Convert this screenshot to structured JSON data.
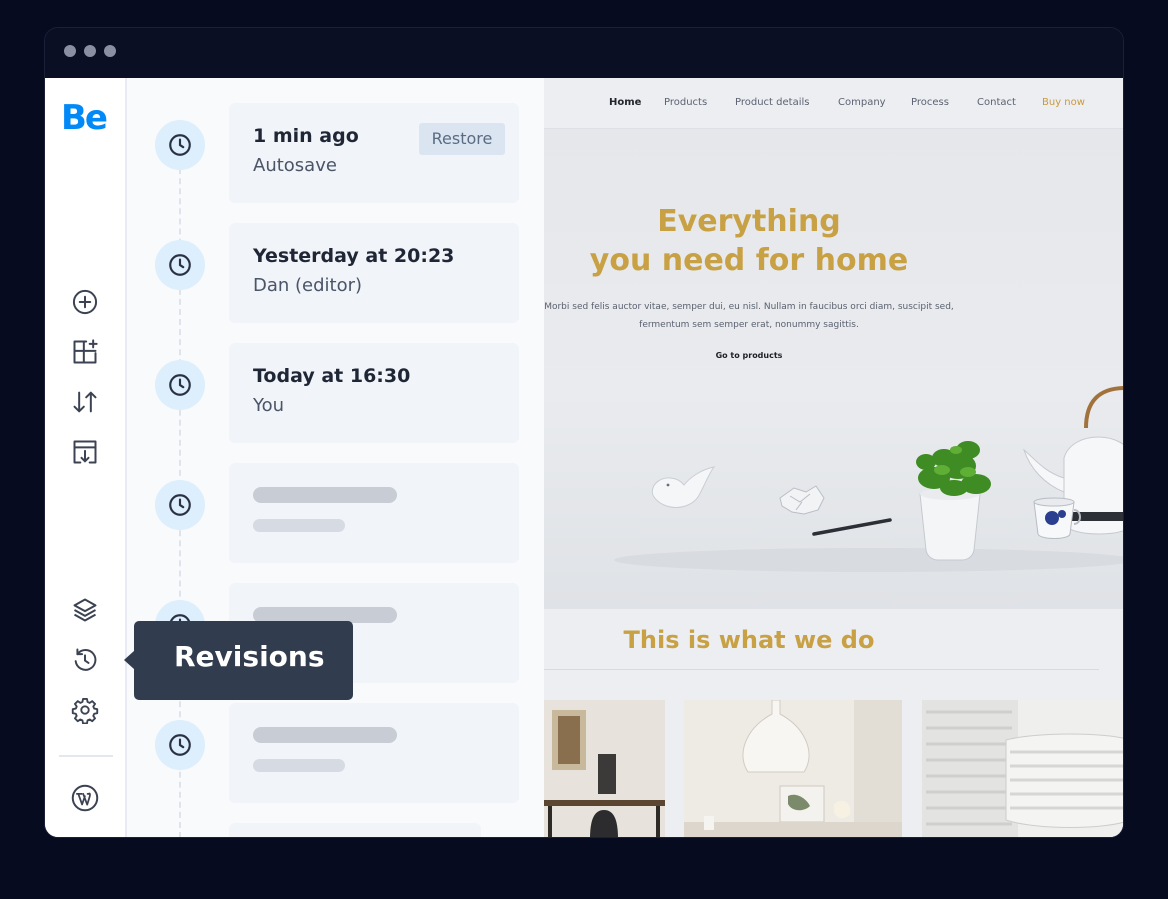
{
  "window": {
    "traffic_lights": [
      "dot",
      "dot",
      "dot"
    ]
  },
  "toolbar": {
    "logo": "Be",
    "tools": [
      {
        "name": "add",
        "icon": "plus-circle-icon"
      },
      {
        "name": "add-section",
        "icon": "layout-add-icon"
      },
      {
        "name": "sort",
        "icon": "arrows-up-down-icon"
      },
      {
        "name": "import",
        "icon": "import-icon"
      },
      {
        "name": "layers",
        "icon": "layers-icon"
      },
      {
        "name": "revisions",
        "icon": "revisions-icon"
      },
      {
        "name": "settings",
        "icon": "gear-icon"
      },
      {
        "name": "wordpress",
        "icon": "wordpress-icon"
      }
    ]
  },
  "revisions": {
    "items": [
      {
        "title": "1 min ago",
        "subtitle": "Autosave",
        "action": "Restore"
      },
      {
        "title": "Yesterday at 20:23",
        "subtitle": "Dan (editor)"
      },
      {
        "title": "Today at 16:30",
        "subtitle": "You"
      }
    ],
    "placeholder_count": 3
  },
  "tooltip": {
    "label": "Revisions"
  },
  "preview": {
    "nav": {
      "home": "Home",
      "products": "Products",
      "product_details": "Product details",
      "company": "Company",
      "process": "Process",
      "contact": "Contact",
      "buy_now": "Buy now"
    },
    "hero": {
      "title_line1": "Everything",
      "title_line2": "you need for home",
      "text_line1": "Morbi sed felis auctor vitae, semper dui, eu nisl. Nullam in faucibus orci diam, suscipit sed,",
      "text_line2": "fermentum sem semper erat, nonummy sagittis.",
      "cta": "Go to products"
    },
    "section_title": "This is what we do"
  },
  "colors": {
    "brand_blue": "#0089f7",
    "accent_gold": "#c9a145",
    "tooltip_bg": "#323c4f",
    "icon_badge": "#ddeefd"
  }
}
